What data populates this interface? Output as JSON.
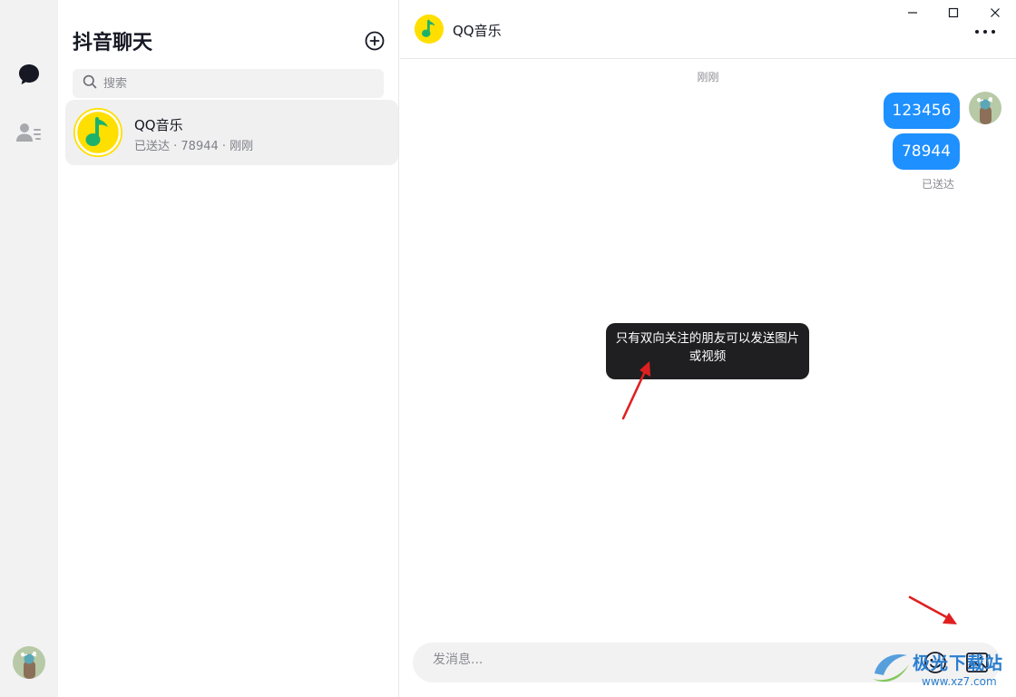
{
  "sidebar": {
    "chat_icon": "chat-bubble-icon",
    "contacts_icon": "contacts-icon",
    "avatar": "user-avatar"
  },
  "conversation_list": {
    "title": "抖音聊天",
    "new_chat_icon": "plus-circle-icon",
    "search": {
      "placeholder": "搜索",
      "value": ""
    },
    "items": [
      {
        "name": "QQ音乐",
        "subtitle": "已送达 · 78944 · 刚刚",
        "avatar": "qq-music-logo"
      }
    ]
  },
  "chat": {
    "header": {
      "title": "QQ音乐",
      "more_icon": "more-dots-icon"
    },
    "window_controls": [
      "minimize-icon",
      "maximize-icon",
      "close-icon"
    ],
    "timestamp": "刚刚",
    "messages": [
      {
        "sender": "me",
        "text": "123456"
      },
      {
        "sender": "me",
        "text": "78944"
      }
    ],
    "delivery_status": "已送达",
    "tooltip": "只有双向关注的朋友可以发送图片或视频",
    "composer": {
      "placeholder": "发消息...",
      "value": "",
      "emoji_icon": "emoji-icon",
      "image_icon": "image-icon"
    },
    "annotation_color": "#e02020",
    "accent_color": "#1e90ff"
  },
  "watermark": {
    "text": "极光下载站",
    "url": "www.xz7.com"
  }
}
